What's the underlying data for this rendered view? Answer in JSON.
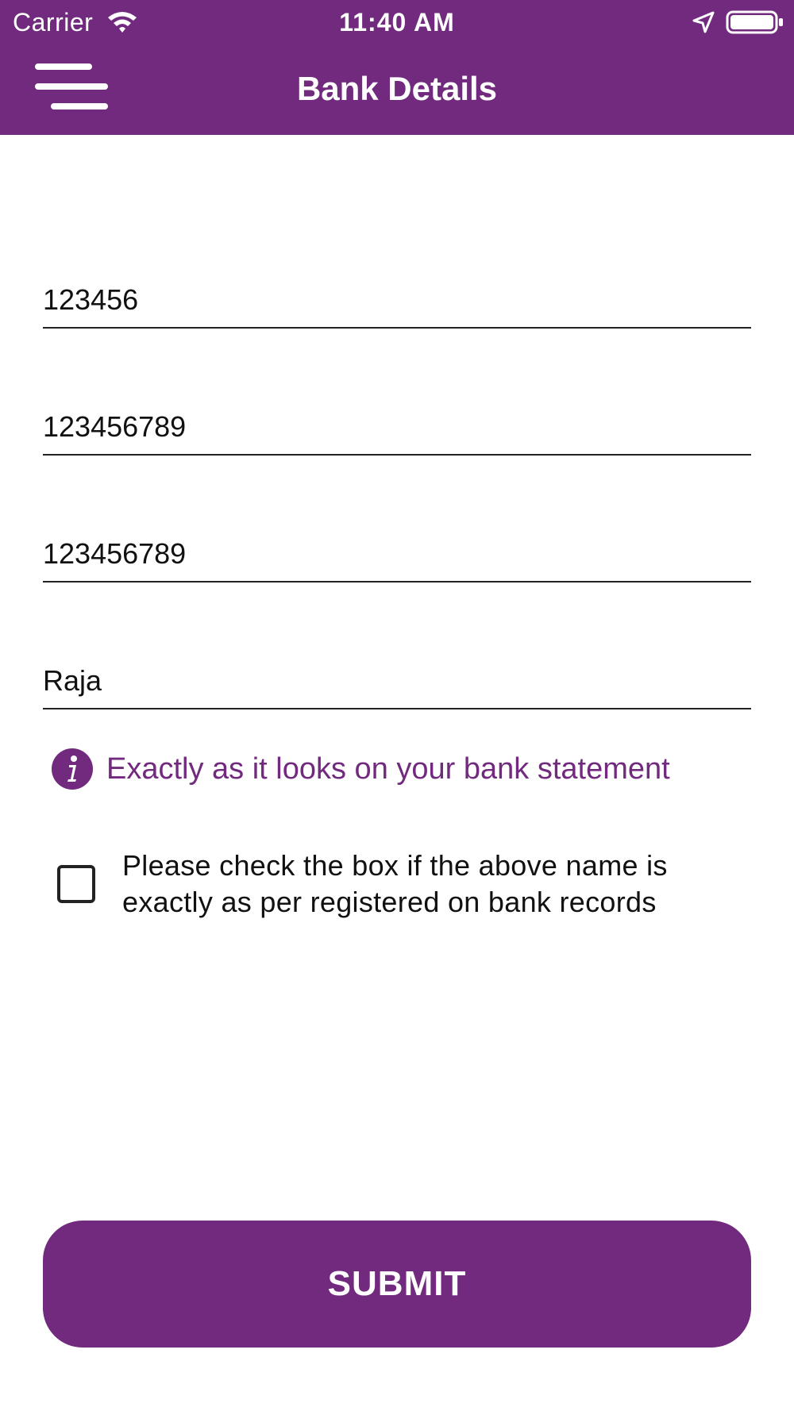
{
  "status_bar": {
    "carrier": "Carrier",
    "time": "11:40 AM",
    "icons": [
      "wifi-icon",
      "location-arrow-icon",
      "battery-icon"
    ]
  },
  "header": {
    "title": "Bank Details",
    "menu_icon": "hamburger-menu-icon",
    "background_color": "#712a7e"
  },
  "form": {
    "fields": [
      {
        "name": "field-1",
        "value": "123456"
      },
      {
        "name": "field-2",
        "value": "123456789"
      },
      {
        "name": "field-3",
        "value": "123456789"
      },
      {
        "name": "field-4",
        "value": "Raja"
      }
    ],
    "info_note": "Exactly as it looks on your bank statement",
    "info_icon": "info-icon",
    "checkbox": {
      "label": "Please check the box if the above name is exactly as per registered on bank records",
      "checked": false
    }
  },
  "actions": {
    "submit_label": "SUBMIT"
  },
  "colors": {
    "accent": "#712a7e",
    "text": "#111111",
    "background": "#ffffff"
  }
}
